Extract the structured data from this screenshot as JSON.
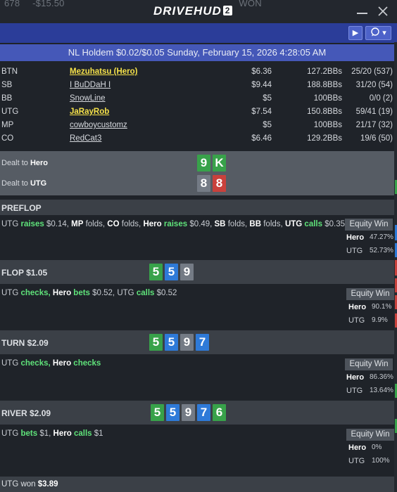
{
  "titlebar": {
    "bg_stats": [
      "678",
      "-$15.50",
      "WON"
    ],
    "logo_text": "DRIVEHUD",
    "logo_badge": "2",
    "minimize_icon": "minimize-icon",
    "close_icon": "close-icon"
  },
  "toolbar": {
    "play_icon": "▶",
    "chat_icon": "🗨",
    "dropdown_icon": "▾"
  },
  "header": {
    "title": "NL Holdem $0.02/$0.05 Sunday, February 15, 2026 4:28:05 AM"
  },
  "players": [
    {
      "pos": "BTN",
      "name": "Mezuhatsu (Hero)",
      "stack": "$6.36",
      "bbs": "127.2BBs",
      "stats": "25/20 (537)",
      "highlight": true
    },
    {
      "pos": "SB",
      "name": "I BuDDaH I",
      "stack": "$9.44",
      "bbs": "188.8BBs",
      "stats": "31/20 (54)",
      "highlight": false
    },
    {
      "pos": "BB",
      "name": "SnowLine",
      "stack": "$5",
      "bbs": "100BBs",
      "stats": "0/0 (2)",
      "highlight": false
    },
    {
      "pos": "UTG",
      "name": "JaRayRob",
      "stack": "$7.54",
      "bbs": "150.8BBs",
      "stats": "59/41 (19)",
      "highlight": true
    },
    {
      "pos": "MP",
      "name": "cowboycustomz",
      "stack": "$5",
      "bbs": "100BBs",
      "stats": "21/17 (32)",
      "highlight": false
    },
    {
      "pos": "CO",
      "name": "RedCat3",
      "stack": "$6.46",
      "bbs": "129.2BBs",
      "stats": "19/6 (50)",
      "highlight": false
    }
  ],
  "dealt": {
    "hero_prefix": "Dealt to ",
    "hero_name": "Hero",
    "hero_cards": [
      "9",
      "K"
    ],
    "utg_prefix": "Dealt to ",
    "utg_name": "UTG",
    "utg_cards": [
      "8",
      "8"
    ]
  },
  "equity_header": "Equity Win",
  "streets": {
    "preflop": {
      "title": "PREFLOP",
      "a1_who": "UTG",
      "a1_verb": "raises",
      "a1_amt": "$0.14,",
      "a2_who": "MP",
      "a2_verb": "folds,",
      "a3_who": "CO",
      "a3_verb": "folds,",
      "a4_who": "Hero",
      "a4_verb": "raises",
      "a4_amt": "$0.49,",
      "a5_who": "SB",
      "a5_verb": "folds,",
      "a6_who": "BB",
      "a6_verb": "folds,",
      "a7_who": "UTG",
      "a7_verb": "calls",
      "a7_amt": "$0.35",
      "eq1_name": "Hero",
      "eq1_val": "47.27%",
      "eq2_name": "UTG",
      "eq2_val": "52.73%"
    },
    "flop": {
      "title": "FLOP  $1.05",
      "cards": [
        "5",
        "5",
        "9"
      ],
      "a1_who": "UTG",
      "a1_verb": "checks,",
      "a2_who": "Hero",
      "a2_verb": "bets",
      "a2_amt": "$0.52,",
      "a3_who": "UTG",
      "a3_verb": "calls",
      "a3_amt": "$0.52",
      "eq1_name": "Hero",
      "eq1_val": "90.1%",
      "eq2_name": "UTG",
      "eq2_val": "9.9%"
    },
    "turn": {
      "title": "TURN  $2.09",
      "cards": [
        "5",
        "5",
        "9",
        "7"
      ],
      "a1_who": "UTG",
      "a1_verb": "checks,",
      "a2_who": "Hero",
      "a2_verb": "checks",
      "eq1_name": "Hero",
      "eq1_val": "86.36%",
      "eq2_name": "UTG",
      "eq2_val": "13.64%"
    },
    "river": {
      "title": "RIVER  $2.09",
      "cards": [
        "5",
        "5",
        "9",
        "7",
        "6"
      ],
      "a1_who": "UTG",
      "a1_verb": "bets",
      "a1_amt": "$1,",
      "a2_who": "Hero",
      "a2_verb": "calls",
      "a2_amt": "$1",
      "eq1_name": "Hero",
      "eq1_val": "0%",
      "eq2_name": "UTG",
      "eq2_val": "100%"
    }
  },
  "footer": {
    "prefix": "UTG won ",
    "amount": "$3.89"
  },
  "colors": {
    "accent_blue": "#2b3d99",
    "header_blue": "#4558b8",
    "action_green": "#5fe27a",
    "hero_yellow": "#f6e24a",
    "card_green": "#38a24a",
    "card_blue": "#2e7ad8",
    "card_red": "#c9413c",
    "card_gray": "#747b85"
  }
}
